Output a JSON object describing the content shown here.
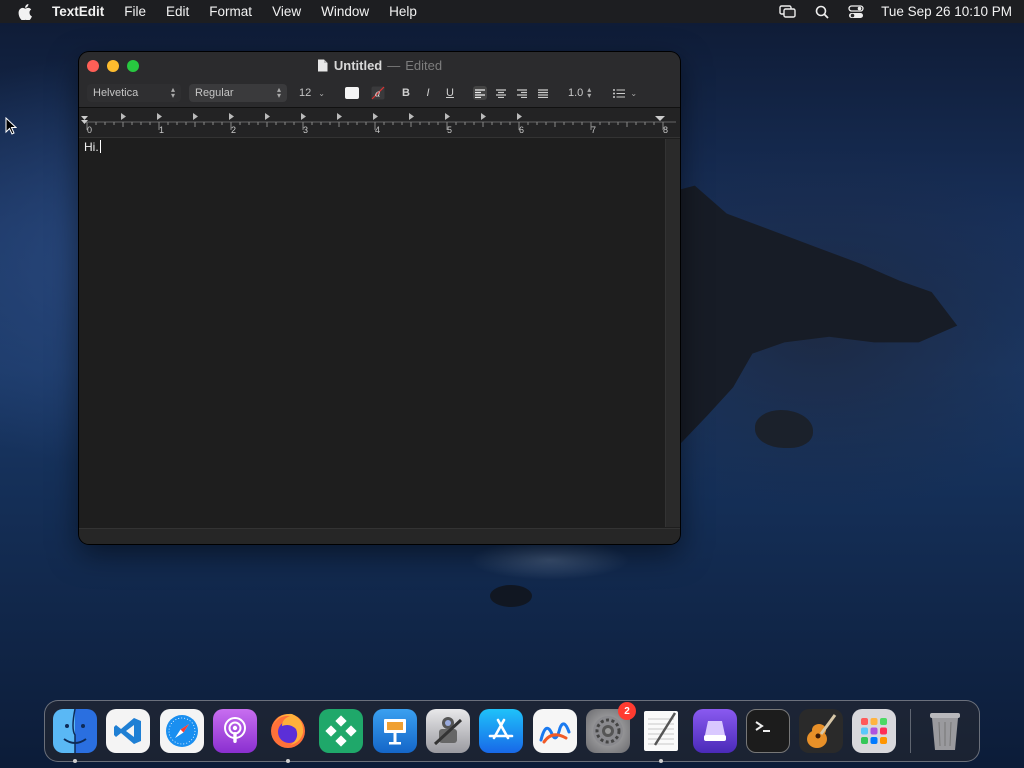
{
  "menubar": {
    "app_name": "TextEdit",
    "items": [
      "File",
      "Edit",
      "Format",
      "View",
      "Window",
      "Help"
    ],
    "clock": "Tue Sep 26  10:10 PM",
    "status_icons": [
      "screen-mirroring-icon",
      "search-icon",
      "control-center-icon"
    ]
  },
  "window": {
    "title": "Untitled",
    "dash": "—",
    "edited_label": "Edited",
    "toolbar": {
      "font_family": "Helvetica",
      "font_style": "Regular",
      "font_size": "12",
      "line_spacing": "1.0",
      "bold_label": "B",
      "italic_label": "I",
      "underline_label": "U",
      "highlight_label": "a"
    },
    "ruler_numbers": [
      "0",
      "1",
      "2",
      "3",
      "4",
      "5",
      "6",
      "7",
      "8"
    ],
    "document_text": "Hi."
  },
  "dock": {
    "apps": [
      {
        "name": "Finder",
        "icon": "finder-icon",
        "running": true
      },
      {
        "name": "Visual Studio Code",
        "icon": "vscode-icon",
        "running": false
      },
      {
        "name": "Safari",
        "icon": "safari-icon",
        "running": false
      },
      {
        "name": "Podcasts",
        "icon": "podcasts-icon",
        "running": false
      },
      {
        "name": "Firefox",
        "icon": "firefox-icon",
        "running": true
      },
      {
        "name": "Git Tool",
        "icon": "diamond-app-icon",
        "running": false
      },
      {
        "name": "Keynote",
        "icon": "keynote-icon",
        "running": false
      },
      {
        "name": "Automator",
        "icon": "automator-icon",
        "running": false
      },
      {
        "name": "App Store",
        "icon": "app-store-icon",
        "running": false
      },
      {
        "name": "Freeform",
        "icon": "freeform-icon",
        "running": false
      },
      {
        "name": "System Settings",
        "icon": "settings-icon",
        "running": false,
        "badge": "2"
      },
      {
        "name": "TextEdit",
        "icon": "textedit-icon",
        "running": true
      },
      {
        "name": "Apple Configurator",
        "icon": "configurator-icon",
        "running": false
      },
      {
        "name": "Terminal",
        "icon": "terminal-icon",
        "running": false
      },
      {
        "name": "GarageBand",
        "icon": "garageband-icon",
        "running": false
      },
      {
        "name": "Launchpad",
        "icon": "launchpad-icon",
        "running": false
      }
    ],
    "trash_icon": "trash-icon"
  }
}
